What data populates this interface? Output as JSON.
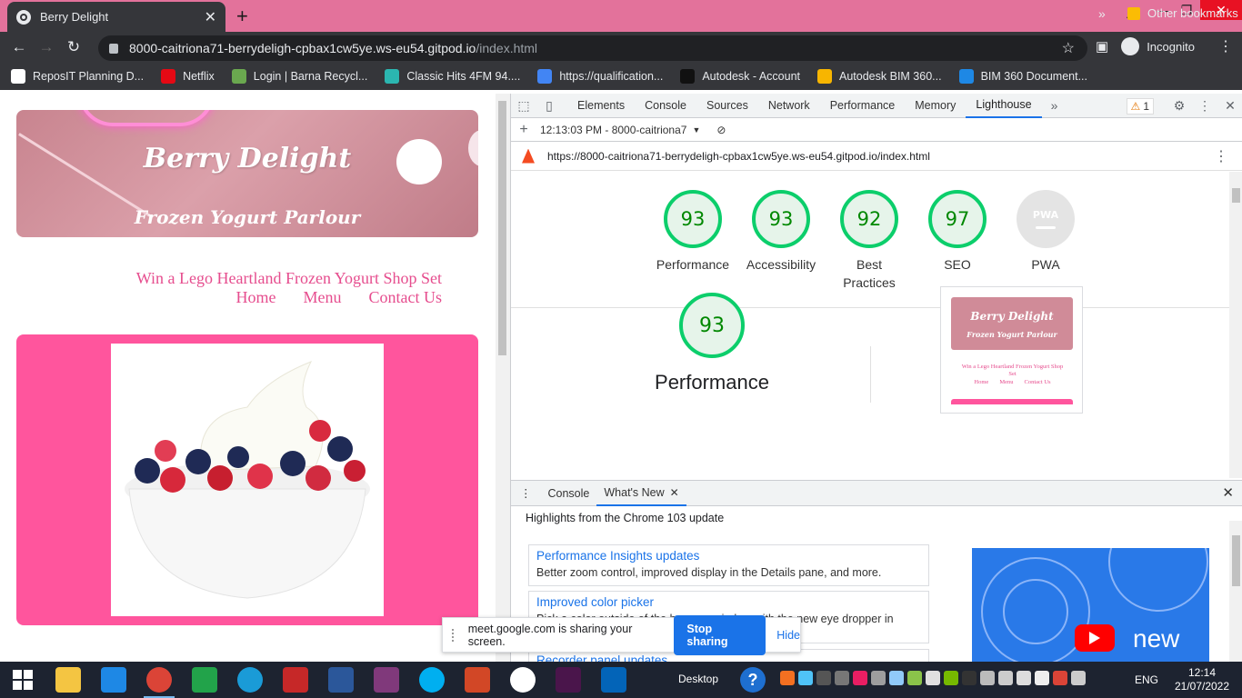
{
  "browser": {
    "tab_title": "Berry Delight",
    "url_host": "8000-caitriona71-berrydeligh-cpbax1cw5ye.ws-eu54.gitpod.io",
    "url_path": "/index.html",
    "profile_label": "Incognito",
    "bookmarks": [
      {
        "label": "ReposIT Planning D...",
        "color": "#ffffff"
      },
      {
        "label": "Netflix",
        "color": "#e50914"
      },
      {
        "label": "Login | Barna Recycl...",
        "color": "#6aa84f"
      },
      {
        "label": "Classic Hits 4FM 94....",
        "color": "#2bb6b0"
      },
      {
        "label": "https://qualification...",
        "color": "#4285f4"
      },
      {
        "label": "Autodesk - Account",
        "color": "#111111"
      },
      {
        "label": "Autodesk BIM 360...",
        "color": "#f7b500"
      },
      {
        "label": "BIM 360 Document...",
        "color": "#1e88e5"
      }
    ],
    "other_bookmarks": "Other bookmarks"
  },
  "site": {
    "hero_title": "Berry Delight",
    "hero_subtitle": "Frozen Yogurt Parlour",
    "promo_link": "Win a Lego Heartland Frozen Yogurt Shop Set",
    "nav": [
      "Home",
      "Menu",
      "Contact Us"
    ]
  },
  "devtools": {
    "tabs": [
      "Elements",
      "Console",
      "Sources",
      "Network",
      "Performance",
      "Memory",
      "Lighthouse"
    ],
    "active_tab": "Lighthouse",
    "warning_count": "1",
    "report_selector": "12:13:03 PM - 8000-caitriona7",
    "report_url": "https://8000-caitriona71-berrydeligh-cpbax1cw5ye.ws-eu54.gitpod.io/index.html",
    "scores": [
      {
        "label": "Performance",
        "value": "93"
      },
      {
        "label": "Accessibility",
        "value": "93"
      },
      {
        "label": "Best Practices",
        "value": "92"
      },
      {
        "label": "SEO",
        "value": "97"
      }
    ],
    "pwa": {
      "label": "PWA",
      "badge": "PWA"
    },
    "detail": {
      "value": "93",
      "label": "Performance"
    },
    "thumbnail": {
      "title": "Berry Delight",
      "subtitle": "Frozen Yogurt Parlour",
      "promo": "Win a Lego Heartland Frozen Yogurt Shop Set",
      "nav": [
        "Home",
        "Menu",
        "Contact Us"
      ]
    },
    "drawer": {
      "tabs": [
        "Console",
        "What's New"
      ],
      "active_tab": "What's New",
      "highlights": "Highlights from the Chrome 103 update",
      "news": [
        {
          "title": "Performance Insights updates",
          "desc": "Better zoom control, improved display in the Details pane, and more."
        },
        {
          "title": "Improved color picker",
          "desc": "Pick a color outside of the browser window with the new eye dropper in"
        },
        {
          "title": "Recorder panel updates",
          "desc": ""
        }
      ],
      "video_text": "new"
    }
  },
  "share_banner": {
    "message": "meet.google.com is sharing your screen.",
    "stop": "Stop sharing",
    "hide": "Hide"
  },
  "taskbar": {
    "desktop_label": "Desktop",
    "language": "ENG",
    "time": "12:14",
    "date": "21/07/2022",
    "apps": [
      {
        "name": "file-explorer",
        "color": "#f4c542"
      },
      {
        "name": "internet-explorer",
        "color": "#1e88e5"
      },
      {
        "name": "chrome",
        "color": "#db4437"
      },
      {
        "name": "store",
        "color": "#22a34a"
      },
      {
        "name": "edge",
        "color": "#1a9bd7"
      },
      {
        "name": "snipping",
        "color": "#c62828"
      },
      {
        "name": "word",
        "color": "#2b579a"
      },
      {
        "name": "onenote",
        "color": "#80397b"
      },
      {
        "name": "skype",
        "color": "#00aff0"
      },
      {
        "name": "powerpoint-app",
        "color": "#d24726"
      },
      {
        "name": "emoji-app",
        "color": "#ffffff"
      },
      {
        "name": "slack",
        "color": "#4a154b"
      },
      {
        "name": "onedrive",
        "color": "#0364b8"
      }
    ]
  }
}
